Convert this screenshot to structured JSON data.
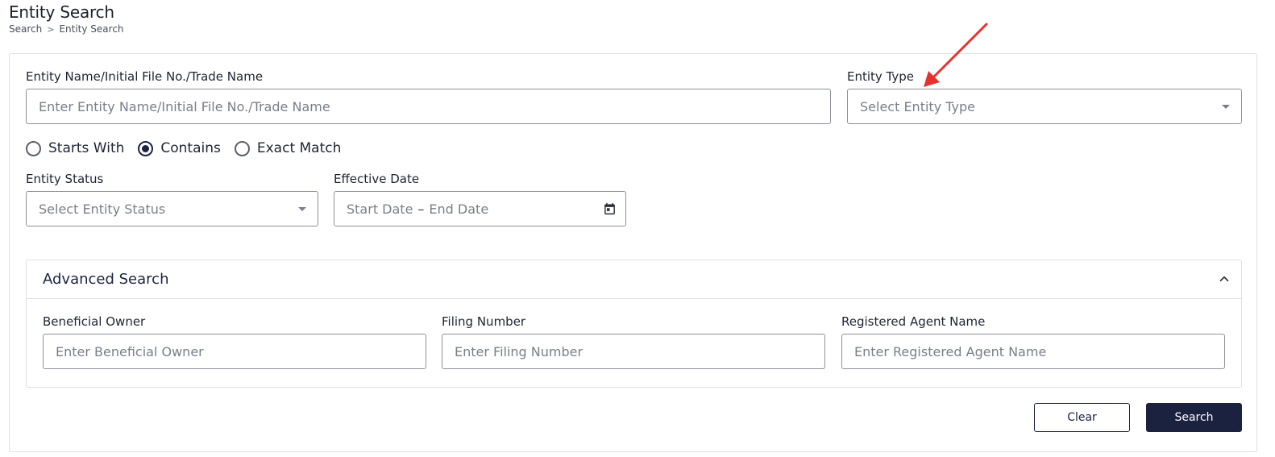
{
  "header": {
    "title": "Entity Search",
    "breadcrumb": [
      "Search",
      "Entity Search"
    ],
    "breadcrumb_sep": ">"
  },
  "form": {
    "entity_name": {
      "label": "Entity Name/Initial File No./Trade Name",
      "placeholder": "Enter Entity Name/Initial File No./Trade Name",
      "value": ""
    },
    "entity_type": {
      "label": "Entity Type",
      "placeholder": "Select Entity Type"
    },
    "match_mode": {
      "options": [
        "Starts With",
        "Contains",
        "Exact Match"
      ],
      "selected": "Contains"
    },
    "entity_status": {
      "label": "Entity Status",
      "placeholder": "Select Entity Status"
    },
    "effective_date": {
      "label": "Effective Date",
      "start_placeholder": "Start Date",
      "separator": "–",
      "end_placeholder": "End Date",
      "icon": "calendar-icon"
    }
  },
  "advanced_search": {
    "title": "Advanced Search",
    "expanded": true,
    "beneficial_owner": {
      "label": "Beneficial Owner",
      "placeholder": "Enter Beneficial Owner",
      "value": ""
    },
    "filing_number": {
      "label": "Filing Number",
      "placeholder": "Enter Filing Number",
      "value": ""
    },
    "registered_agent": {
      "label": "Registered Agent Name",
      "placeholder": "Enter Registered Agent Name",
      "value": ""
    }
  },
  "actions": {
    "clear_label": "Clear",
    "search_label": "Search"
  },
  "colors": {
    "primary": "#1b2240",
    "border": "#8c909c",
    "annotation_arrow": "#e5322d"
  }
}
